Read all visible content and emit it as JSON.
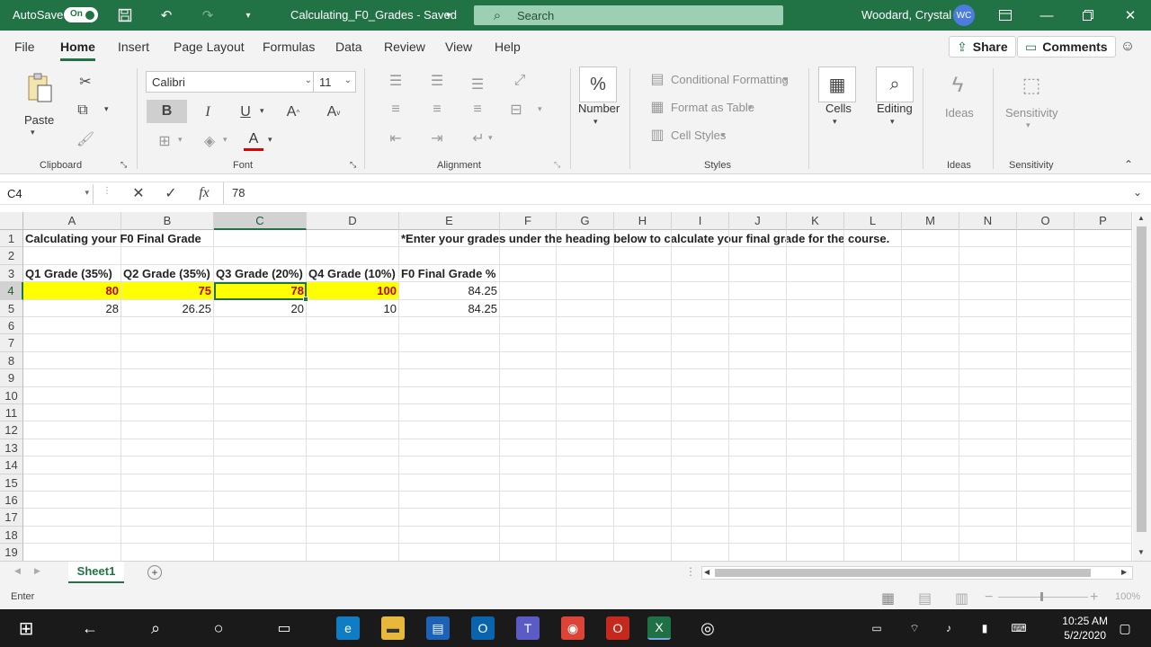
{
  "titlebar": {
    "autosave_label": "AutoSave",
    "autosave_state": "On",
    "doc_title": "Calculating_F0_Grades - Saved",
    "search_placeholder": "Search",
    "user_name": "Woodard, Crystal",
    "user_initials": "WC",
    "accent_color": "#217346"
  },
  "tabs": [
    "File",
    "Home",
    "Insert",
    "Page Layout",
    "Formulas",
    "Data",
    "Review",
    "View",
    "Help"
  ],
  "active_tab": "Home",
  "actions": {
    "share": "Share",
    "comments": "Comments"
  },
  "ribbon": {
    "clipboard": {
      "paste": "Paste",
      "label": "Clipboard"
    },
    "font": {
      "name": "Calibri",
      "size": "11",
      "label": "Font",
      "bold": "B",
      "italic": "I",
      "underline": "U"
    },
    "alignment": {
      "label": "Alignment"
    },
    "number": {
      "symbol": "%",
      "label": "Number"
    },
    "styles": {
      "conditional": "Conditional Formatting",
      "format_table": "Format as Table",
      "cell_styles": "Cell Styles",
      "label": "Styles"
    },
    "cells": {
      "label": "Cells"
    },
    "editing": {
      "label": "Editing"
    },
    "ideas": {
      "button": "Ideas",
      "label": "Ideas"
    },
    "sensitivity": {
      "button": "Sensitivity",
      "label": "Sensitivity"
    }
  },
  "formula_bar": {
    "name_box": "C4",
    "cancel": "✕",
    "enter": "✓",
    "fx": "fx",
    "value": "78"
  },
  "grid": {
    "columns": [
      "A",
      "B",
      "C",
      "D",
      "E",
      "F",
      "G",
      "H",
      "I",
      "J",
      "K",
      "L",
      "M",
      "N",
      "O",
      "P"
    ],
    "rows": [
      "1",
      "2",
      "3",
      "4",
      "5",
      "6",
      "7",
      "8",
      "9",
      "10",
      "11",
      "12",
      "13",
      "14",
      "15",
      "16",
      "17",
      "18",
      "19"
    ],
    "active_cell": "C4",
    "cells": {
      "A1": "Calculating your F0 Final Grade",
      "E1": "*Enter your grades under the heading below to calculate your final grade for the course.",
      "A3": "Q1 Grade (35%)",
      "B3": "Q2 Grade (35%)",
      "C3": "Q3 Grade (20%)",
      "D3": "Q4 Grade (10%)",
      "E3": "F0 Final Grade %",
      "A4": "80",
      "B4": "75",
      "C4": "78",
      "D4": "100",
      "E4": "84.25",
      "A5": "28",
      "B5": "26.25",
      "C5": "20",
      "D5": "10",
      "E5": "84.25"
    },
    "highlight_color": "#ffff00",
    "highlight_text_color": "#c00000"
  },
  "sheets": [
    "Sheet1"
  ],
  "status": {
    "mode": "Enter",
    "zoom": "100%"
  },
  "taskbar": {
    "time": "10:25 AM",
    "date": "5/2/2020"
  }
}
